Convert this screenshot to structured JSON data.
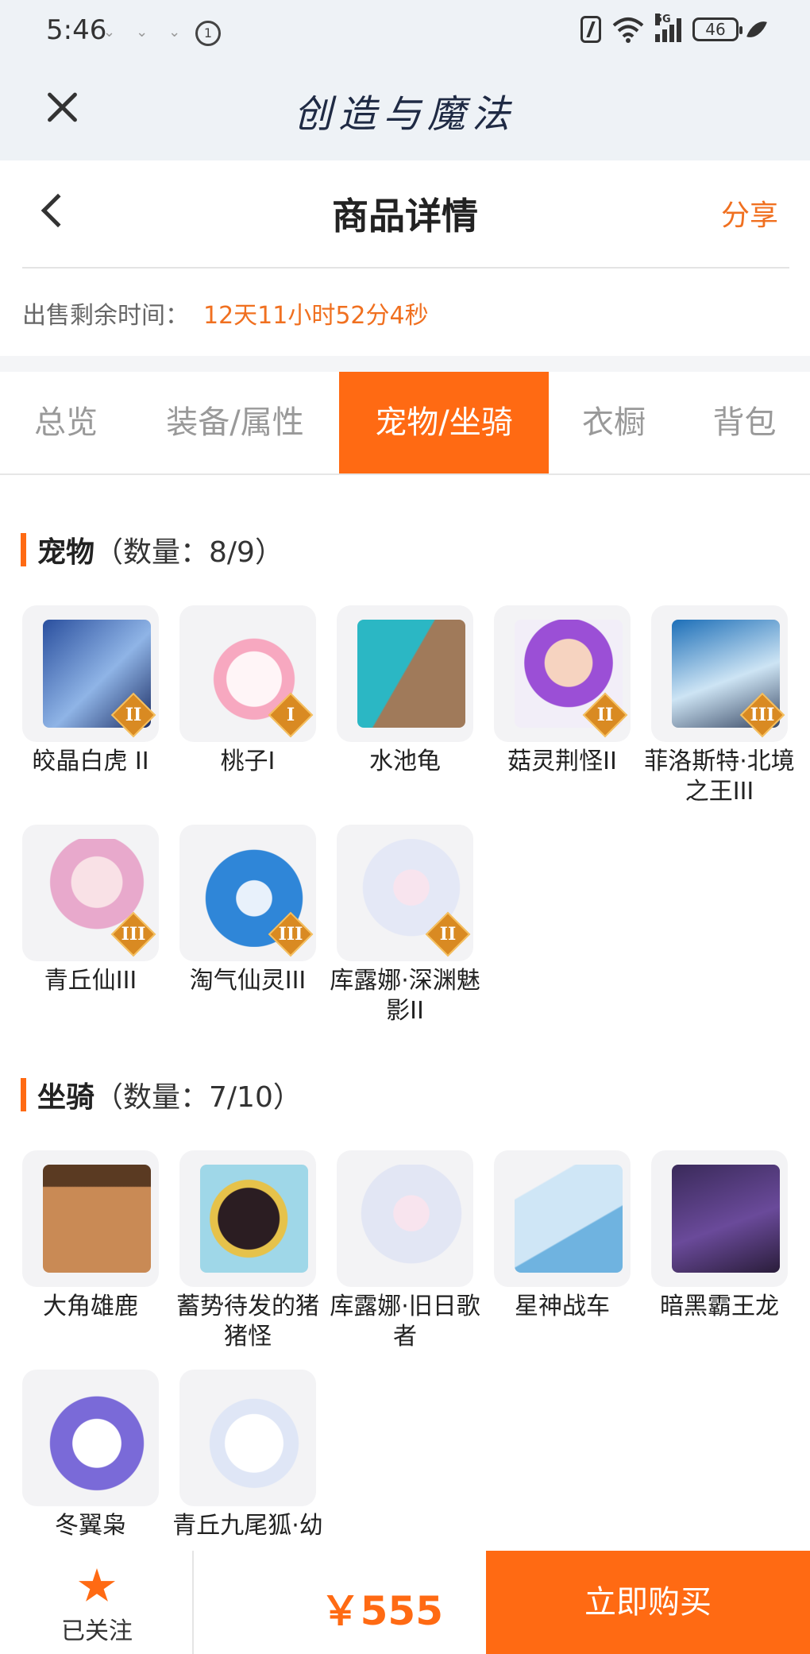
{
  "status_bar": {
    "time": "5:46",
    "battery": "46",
    "network": "5G"
  },
  "app_header": {
    "title": "创造与魔法"
  },
  "nav": {
    "title": "商品详情",
    "share": "分享"
  },
  "sale_time": {
    "label": "出售剩余时间：",
    "value": "12天11小时52分4秒"
  },
  "tabs": [
    {
      "label": "总览",
      "active": false
    },
    {
      "label": "装备/属性",
      "active": false
    },
    {
      "label": "宠物/坐骑",
      "active": true
    },
    {
      "label": "衣橱",
      "active": false
    },
    {
      "label": "背包",
      "active": false
    }
  ],
  "pets": {
    "title": "宠物",
    "count": "（数量：8/9）",
    "items": [
      {
        "name": "皎晶白虎 II",
        "badge": "II"
      },
      {
        "name": "桃子I",
        "badge": "I"
      },
      {
        "name": "水池龟",
        "badge": ""
      },
      {
        "name": "菇灵荆怪II",
        "badge": "II"
      },
      {
        "name": "菲洛斯特·北境之王III",
        "badge": "III"
      },
      {
        "name": "青丘仙III",
        "badge": "III"
      },
      {
        "name": "淘气仙灵III",
        "badge": "III"
      },
      {
        "name": "库露娜·深渊魅影II",
        "badge": "II"
      }
    ]
  },
  "mounts": {
    "title": "坐骑",
    "count": "（数量：7/10）",
    "items": [
      {
        "name": "大角雄鹿"
      },
      {
        "name": "蓄势待发的猪猪怪"
      },
      {
        "name": "库露娜·旧日歌者"
      },
      {
        "name": "星神战车"
      },
      {
        "name": "暗黑霸王龙"
      },
      {
        "name": "冬翼枭"
      },
      {
        "name": "青丘九尾狐·幼"
      }
    ]
  },
  "bottom_bar": {
    "follow": "已关注",
    "price": "￥555",
    "buy": "立即购买"
  },
  "colors": {
    "accent": "#ff6a13",
    "time_highlight": "#f07020"
  }
}
